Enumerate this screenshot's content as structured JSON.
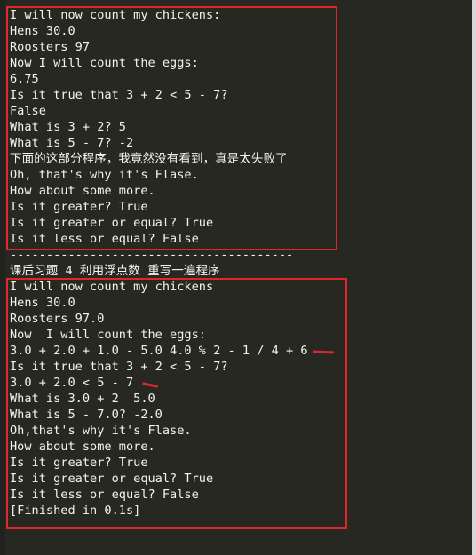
{
  "console": {
    "lines": [
      "I will now count my chickens:",
      "Hens 30.0",
      "Roosters 97",
      "Now I will count the eggs:",
      "6.75",
      "Is it true that 3 + 2 < 5 - 7?",
      "False",
      "What is 3 + 2? 5",
      "What is 5 - 7? -2",
      "下面的这部分程序，我竟然没有看到，真是太失败了",
      "Oh, that's why it's Flase.",
      "How about some more.",
      "Is it greater? True",
      "Is it greater or equal? True",
      "Is it less or equal? False",
      "---------------------------------------",
      "课后习题 4 利用浮点数 重写一遍程序",
      "I will now count my chickens",
      "Hens 30.0",
      "Roosters 97.0",
      "Now  I will count the eggs:",
      "3.0 + 2.0 + 1.0 - 5.0 4.0 % 2 - 1 / 4 + 6",
      "Is it true that 3 + 2 < 5 - 7?",
      "3.0 + 2.0 < 5 - 7",
      "What is 3.0 + 2  5.0",
      "What is 5 - 7.0? -2.0",
      "Oh,that's why it's Flase.",
      "How about some more.",
      "Is it greater? True",
      "Is it greater or equal? True",
      "Is it less or equal? False",
      "[Finished in 0.1s]"
    ]
  },
  "colors": {
    "background": "#272822",
    "text": "#f4f4ee",
    "annotation": "#e0262a"
  }
}
